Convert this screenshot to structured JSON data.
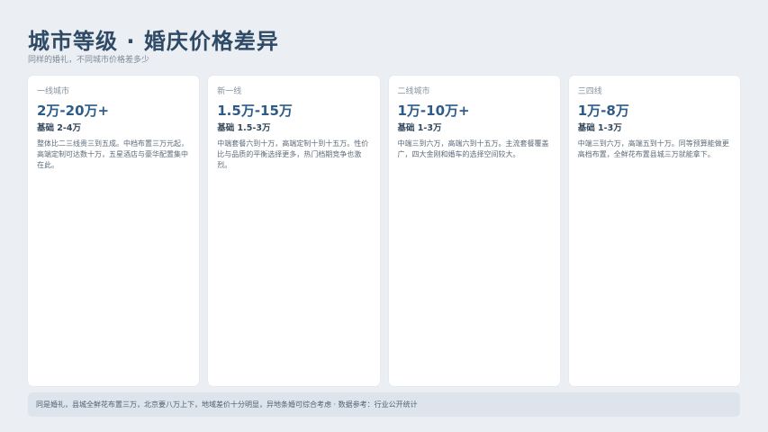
{
  "header": {
    "title": "城市等级 · 婚庆价格差异",
    "subtitle": "同样的婚礼，不同城市价格差多少"
  },
  "cards": [
    {
      "tier": "一线城市",
      "price": "2万-20万+",
      "base": "基础 2-4万",
      "desc": "整体比二三线贵三到五成。中档布置三万元起，高端定制可达数十万，五星酒店与豪华配置集中在此。"
    },
    {
      "tier": "新一线",
      "price": "1.5万-15万",
      "base": "基础 1.5-3万",
      "desc": "中端套餐六到十万，高端定制十到十五万。性价比与品质的平衡选择更多，热门档期竞争也激烈。"
    },
    {
      "tier": "二线城市",
      "price": "1万-10万+",
      "base": "基础 1-3万",
      "desc": "中端三到六万，高端六到十五万。主流套餐覆盖广，四大金刚和婚车的选择空间较大。"
    },
    {
      "tier": "三四线",
      "price": "1万-8万",
      "base": "基础 1-3万",
      "desc": "中端三到六万，高端五到十万。同等预算能做更高档布置，全鲜花布置县城三万就能拿下。"
    }
  ],
  "footer": {
    "note": "同是婚礼，县城全鲜花布置三万，北京要八万上下，地域差价十分明显，异地条婚可综合考虑 · 数据参考：行业公开统计"
  }
}
